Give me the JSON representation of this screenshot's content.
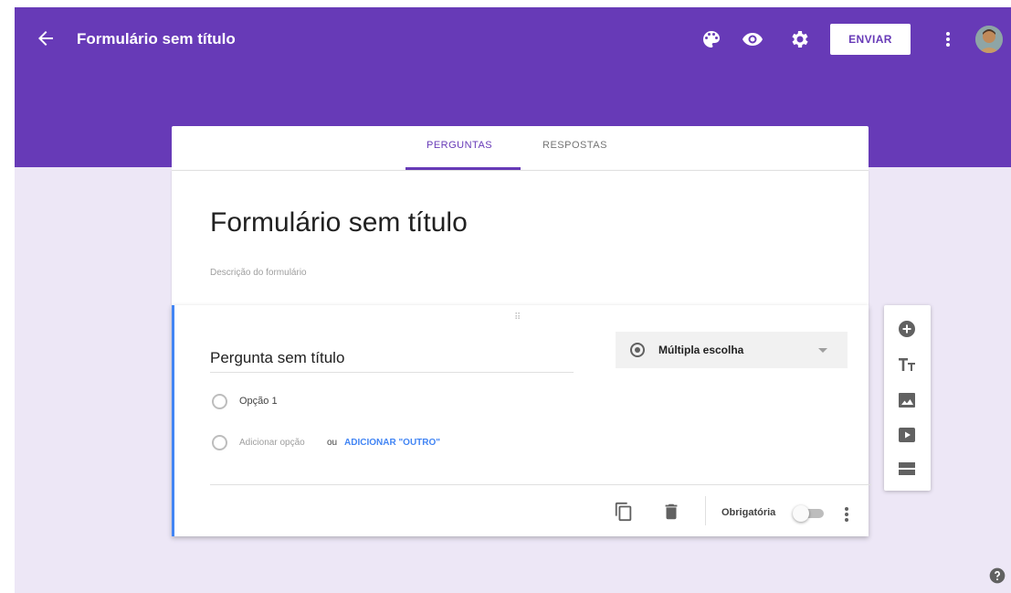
{
  "header": {
    "title": "Formulário sem título",
    "send_label": "ENVIAR",
    "back_icon": "arrow-back-icon",
    "icons": [
      "palette-icon",
      "eye-icon",
      "gear-icon",
      "more-vert-icon"
    ],
    "accent_color": "#673ab7"
  },
  "tabs": [
    {
      "label": "PERGUNTAS",
      "active": true
    },
    {
      "label": "RESPOSTAS",
      "active": false
    }
  ],
  "form": {
    "title": "Formulário sem título",
    "description_placeholder": "Descrição do formulário"
  },
  "question": {
    "title": "Pergunta sem título",
    "type": "Múltipla escolha",
    "options": [
      "Opção 1"
    ],
    "add_option": "Adicionar opção",
    "or": "ou",
    "add_other": "ADICIONAR \"OUTRO\"",
    "required_label": "Obrigatória",
    "required": false
  },
  "side_tools": [
    "add-circle-icon",
    "title-text-icon",
    "image-icon",
    "video-icon",
    "section-icon"
  ]
}
